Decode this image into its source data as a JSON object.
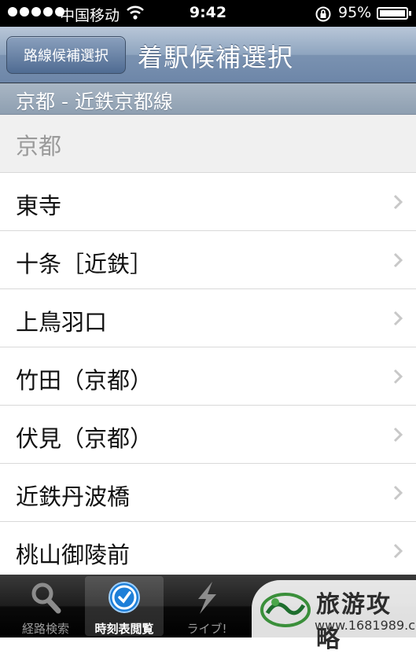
{
  "status_bar": {
    "carrier": "中国移动",
    "time": "9:42",
    "battery_percent": "95%"
  },
  "nav": {
    "back_label": "路線候補選択",
    "title": "着駅候補選択"
  },
  "section_header": "京都 - 近鉄京都線",
  "stations": [
    {
      "name": "京都",
      "disabled": true
    },
    {
      "name": "東寺",
      "disabled": false
    },
    {
      "name": "十条［近鉄］",
      "disabled": false
    },
    {
      "name": "上鳥羽口",
      "disabled": false
    },
    {
      "name": "竹田（京都）",
      "disabled": false
    },
    {
      "name": "伏見（京都）",
      "disabled": false
    },
    {
      "name": "近鉄丹波橋",
      "disabled": false
    },
    {
      "name": "桃山御陵前",
      "disabled": false
    }
  ],
  "tabs": [
    {
      "label": "経路検索",
      "icon": "search-icon",
      "active": false
    },
    {
      "label": "時刻表閲覧",
      "icon": "clock-icon",
      "active": true
    },
    {
      "label": "ライブ!",
      "icon": "lightning-icon",
      "active": false
    }
  ],
  "watermark": {
    "title": "旅游攻略",
    "url": "www.1681989.com"
  },
  "colors": {
    "nav_bar": "#7a92b1",
    "section_header": "#9aa9ba",
    "disabled_row": "#f0f0f0",
    "tab_bar": "#000000"
  }
}
